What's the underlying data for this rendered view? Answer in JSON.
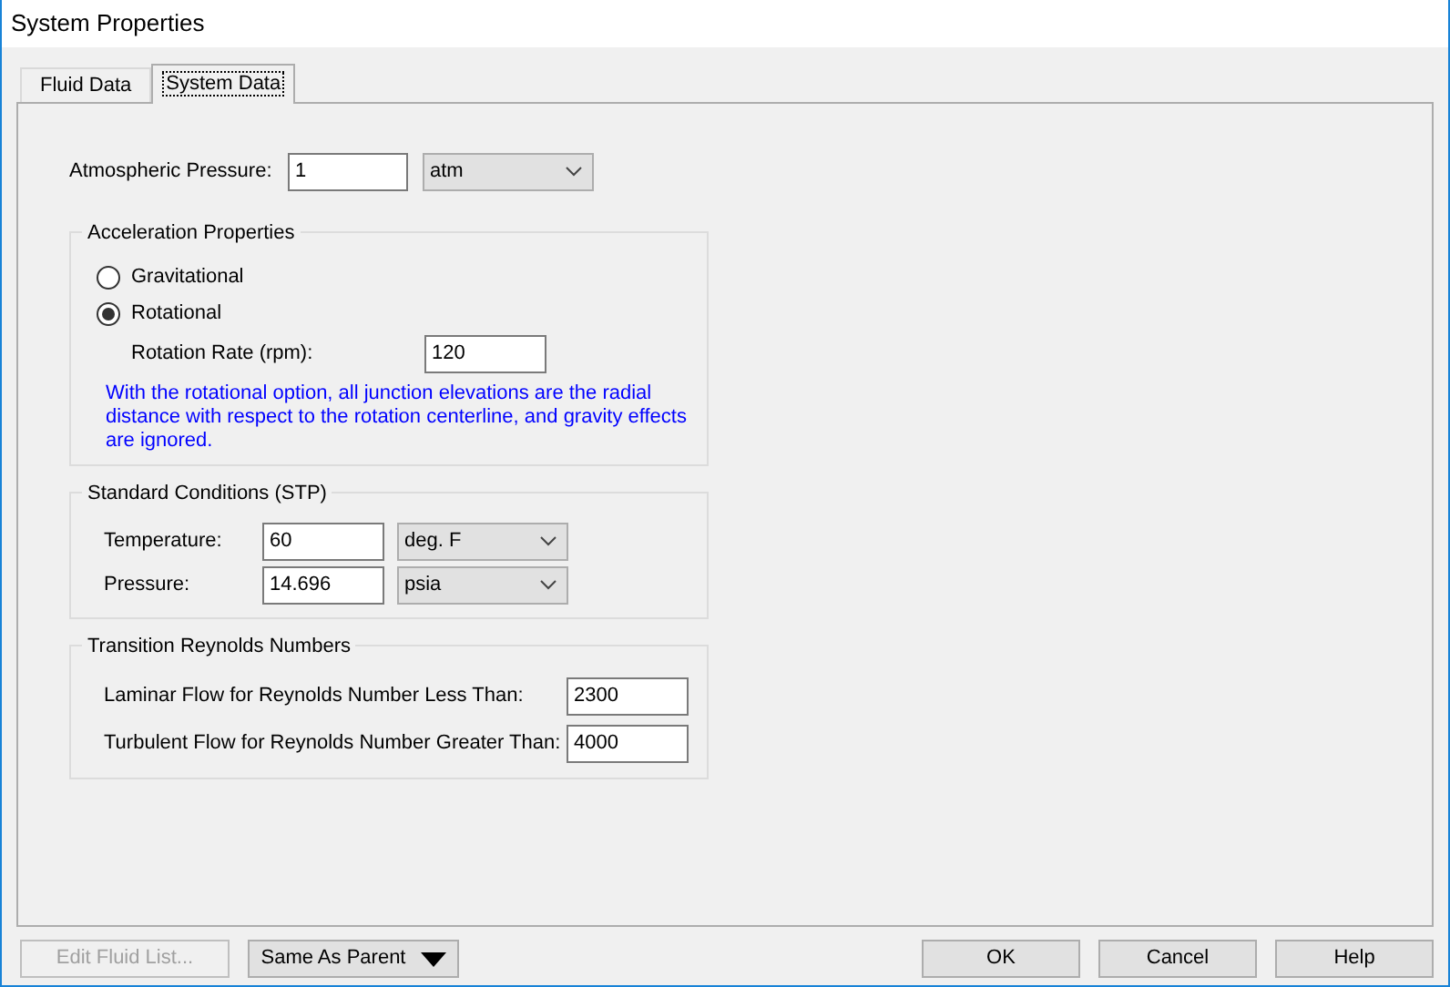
{
  "window": {
    "title": "System Properties"
  },
  "tabs": [
    {
      "label": "Fluid Data",
      "selected": false
    },
    {
      "label": "System Data",
      "selected": true
    }
  ],
  "atmospheric_pressure": {
    "label": "Atmospheric Pressure:",
    "value": "1",
    "unit": "atm"
  },
  "acceleration": {
    "title": "Acceleration Properties",
    "options": [
      {
        "label": "Gravitational",
        "selected": false
      },
      {
        "label": "Rotational",
        "selected": true
      }
    ],
    "rotation_rate": {
      "label": "Rotation Rate (rpm):",
      "value": "120"
    },
    "note": "With the rotational option, all junction elevations are the radial distance with respect to the rotation centerline, and gravity effects are ignored."
  },
  "standard_conditions": {
    "title": "Standard Conditions (STP)",
    "fields": [
      {
        "label": "Temperature:",
        "value": "60",
        "unit": "deg. F"
      },
      {
        "label": "Pressure:",
        "value": "14.696",
        "unit": "psia"
      }
    ]
  },
  "transition_reynolds": {
    "title": "Transition Reynolds Numbers",
    "fields": [
      {
        "label": "Laminar Flow for Reynolds Number Less Than:",
        "value": "2300"
      },
      {
        "label": "Turbulent Flow for Reynolds Number Greater Than:",
        "value": "4000"
      }
    ]
  },
  "buttons": [
    {
      "label": "Edit Fluid List...",
      "disabled": true
    },
    {
      "label": "Same As Parent",
      "kind": "dropdown",
      "disabled": false
    },
    {
      "label": "OK",
      "disabled": false
    },
    {
      "label": "Cancel",
      "disabled": false
    },
    {
      "label": "Help",
      "disabled": false
    }
  ]
}
